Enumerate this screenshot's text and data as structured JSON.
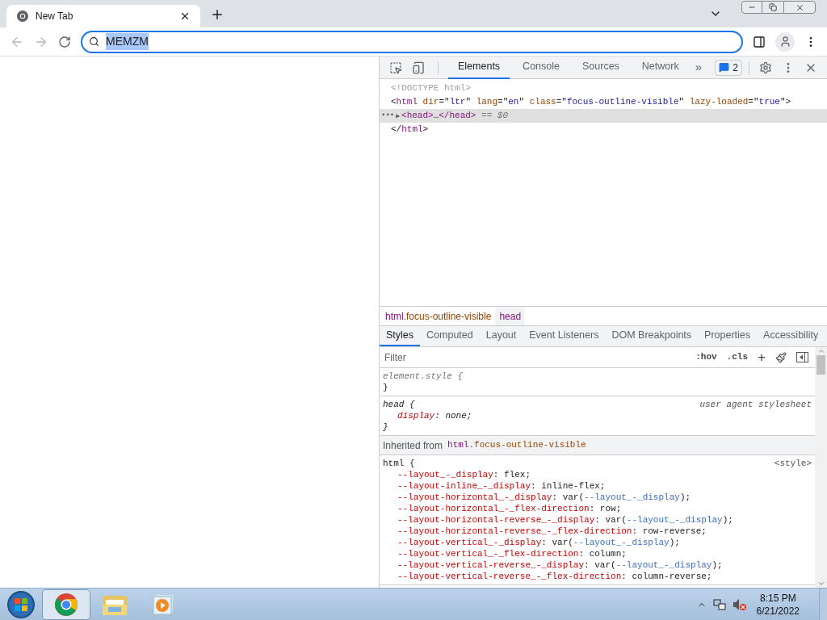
{
  "browser": {
    "tabs": [
      {
        "title": "New Tab",
        "selected": true
      }
    ],
    "address": {
      "value": "MEMZM",
      "selected": true
    }
  },
  "devtools": {
    "panels": [
      {
        "label": "Elements",
        "selected": true
      },
      {
        "label": "Console",
        "selected": false
      },
      {
        "label": "Sources",
        "selected": false
      },
      {
        "label": "Network",
        "selected": false
      }
    ],
    "more": "»",
    "issues_count": "2",
    "dom_lines": [
      {
        "selected": false,
        "tokens": [
          {
            "kind": "comment",
            "text": "<!DOCTYPE html>"
          }
        ]
      },
      {
        "selected": false,
        "tokens": [
          {
            "kind": "punct",
            "text": "<"
          },
          {
            "kind": "tag",
            "text": "html"
          },
          {
            "kind": "attr",
            "text": " dir"
          },
          {
            "kind": "punct",
            "text": "=\""
          },
          {
            "kind": "attrval",
            "text": "ltr"
          },
          {
            "kind": "punct",
            "text": "\""
          },
          {
            "kind": "attr",
            "text": " lang"
          },
          {
            "kind": "punct",
            "text": "=\""
          },
          {
            "kind": "attrval",
            "text": "en"
          },
          {
            "kind": "punct",
            "text": "\""
          },
          {
            "kind": "attr",
            "text": " class"
          },
          {
            "kind": "punct",
            "text": "=\""
          },
          {
            "kind": "attrval",
            "text": "focus-outline-visible"
          },
          {
            "kind": "punct",
            "text": "\""
          },
          {
            "kind": "attr",
            "text": " lazy-loaded"
          },
          {
            "kind": "punct",
            "text": "=\""
          },
          {
            "kind": "attrval",
            "text": "true"
          },
          {
            "kind": "punct",
            "text": "\">"
          }
        ]
      },
      {
        "selected": true,
        "marker": "•••",
        "expander": "▶",
        "tokens": [
          {
            "kind": "tag",
            "text": "<head>"
          },
          {
            "kind": "punct",
            "text": "…"
          },
          {
            "kind": "tag",
            "text": "</head>"
          },
          {
            "kind": "dim",
            "text": " == $0"
          }
        ]
      },
      {
        "selected": false,
        "tokens": [
          {
            "kind": "punct",
            "text": "</"
          },
          {
            "kind": "tag",
            "text": "html"
          },
          {
            "kind": "punct",
            "text": ">"
          }
        ]
      }
    ],
    "breadcrumbs": [
      {
        "tokens": [
          {
            "kind": "tag",
            "text": "html"
          },
          {
            "kind": "attr",
            "text": ".focus-outline-visible"
          }
        ],
        "selected": false
      },
      {
        "tokens": [
          {
            "kind": "tag",
            "text": "head"
          }
        ],
        "selected": true
      }
    ],
    "style_tabs": [
      {
        "label": "Styles",
        "selected": true
      },
      {
        "label": "Computed",
        "selected": false
      },
      {
        "label": "Layout",
        "selected": false
      },
      {
        "label": "Event Listeners",
        "selected": false
      },
      {
        "label": "DOM Breakpoints",
        "selected": false
      },
      {
        "label": "Properties",
        "selected": false
      },
      {
        "label": "Accessibility",
        "selected": false
      }
    ],
    "filter": {
      "placeholder": "Filter"
    },
    "hov": ":hov",
    "cls": ".cls",
    "add": "+",
    "rules": [
      {
        "kind": "rule",
        "italic": false,
        "lines": [
          [
            {
              "kind": "dim",
              "text": "element.style {"
            }
          ],
          [
            {
              "kind": "punct",
              "text": "}"
            }
          ]
        ]
      },
      {
        "kind": "rule",
        "italic": true,
        "source": "user agent stylesheet",
        "lines": [
          [
            {
              "kind": "punct",
              "text": "head {"
            }
          ],
          [
            {
              "kind": "indent"
            },
            {
              "kind": "prop",
              "text": "display"
            },
            {
              "kind": "punct",
              "text": ": none;"
            }
          ],
          [
            {
              "kind": "punct",
              "text": "}"
            }
          ]
        ]
      },
      {
        "kind": "inherited",
        "label": "Inherited from",
        "tokens": [
          {
            "kind": "tag",
            "text": "html"
          },
          {
            "kind": "attr",
            "text": ".focus-outline-visible"
          }
        ]
      },
      {
        "kind": "rule",
        "italic": false,
        "source": "<style>",
        "lines": [
          [
            {
              "kind": "punct",
              "text": "html {"
            }
          ],
          [
            {
              "kind": "indent"
            },
            {
              "kind": "prop",
              "text": "--layout_-_display"
            },
            {
              "kind": "punct",
              "text": ": flex;"
            }
          ],
          [
            {
              "kind": "indent"
            },
            {
              "kind": "prop",
              "text": "--layout-inline_-_display"
            },
            {
              "kind": "punct",
              "text": ": inline-flex;"
            }
          ],
          [
            {
              "kind": "indent"
            },
            {
              "kind": "prop",
              "text": "--layout-horizontal_-_display"
            },
            {
              "kind": "punct",
              "text": ": var("
            },
            {
              "kind": "var",
              "text": "--layout_-_display"
            },
            {
              "kind": "punct",
              "text": ");"
            }
          ],
          [
            {
              "kind": "indent"
            },
            {
              "kind": "prop",
              "text": "--layout-horizontal_-_flex-direction"
            },
            {
              "kind": "punct",
              "text": ": row;"
            }
          ],
          [
            {
              "kind": "indent"
            },
            {
              "kind": "prop",
              "text": "--layout-horizontal-reverse_-_display"
            },
            {
              "kind": "punct",
              "text": ": var("
            },
            {
              "kind": "var",
              "text": "--layout_-_display"
            },
            {
              "kind": "punct",
              "text": ");"
            }
          ],
          [
            {
              "kind": "indent"
            },
            {
              "kind": "prop",
              "text": "--layout-horizontal-reverse_-_flex-direction"
            },
            {
              "kind": "punct",
              "text": ": row-reverse;"
            }
          ],
          [
            {
              "kind": "indent"
            },
            {
              "kind": "prop",
              "text": "--layout-vertical_-_display"
            },
            {
              "kind": "punct",
              "text": ": var("
            },
            {
              "kind": "var",
              "text": "--layout_-_display"
            },
            {
              "kind": "punct",
              "text": ");"
            }
          ],
          [
            {
              "kind": "indent"
            },
            {
              "kind": "prop",
              "text": "--layout-vertical_-_flex-direction"
            },
            {
              "kind": "punct",
              "text": ": column;"
            }
          ],
          [
            {
              "kind": "indent"
            },
            {
              "kind": "prop",
              "text": "--layout-vertical-reverse_-_display"
            },
            {
              "kind": "punct",
              "text": ": var("
            },
            {
              "kind": "var",
              "text": "--layout_-_display"
            },
            {
              "kind": "punct",
              "text": ");"
            }
          ],
          [
            {
              "kind": "indent"
            },
            {
              "kind": "prop",
              "text": "--layout-vertical-reverse_-_flex-direction"
            },
            {
              "kind": "punct",
              "text": ": column-reverse;"
            }
          ]
        ]
      }
    ]
  },
  "taskbar": {
    "apps": [
      {
        "kind": "chrome",
        "selected": true
      },
      {
        "kind": "folder",
        "selected": false
      },
      {
        "kind": "media",
        "selected": false
      }
    ],
    "time": "8:15 PM",
    "date": "6/21/2022"
  }
}
